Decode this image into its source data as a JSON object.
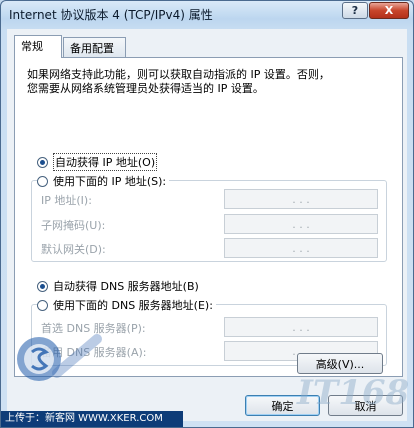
{
  "window": {
    "title": "Internet 协议版本 4 (TCP/IPv4) 属性",
    "help_label": "?",
    "close_label": "X"
  },
  "tabs": [
    {
      "label": "常规",
      "active": true
    },
    {
      "label": "备用配置",
      "active": false
    }
  ],
  "intro": {
    "line1": "如果网络支持此功能，则可以获取自动指派的 IP 设置。否则，",
    "line2": "您需要从网络系统管理员处获得适当的 IP 设置。"
  },
  "ip_section": {
    "auto_label": "自动获得 IP 地址(O)",
    "auto_selected": true,
    "manual_label": "使用下面的 IP 地址(S):",
    "fields": [
      {
        "label": "IP 地址(I):",
        "value": ". . ."
      },
      {
        "label": "子网掩码(U):",
        "value": ". . ."
      },
      {
        "label": "默认网关(D):",
        "value": ". . ."
      }
    ]
  },
  "dns_section": {
    "auto_label": "自动获得 DNS 服务器地址(B)",
    "auto_selected": true,
    "manual_label": "使用下面的 DNS 服务器地址(E):",
    "fields": [
      {
        "label": "首选 DNS 服务器(P):",
        "value": ". . ."
      },
      {
        "label": "备用 DNS 服务器(A):",
        "value": ". . ."
      }
    ]
  },
  "buttons": {
    "advanced": "高级(V)...",
    "ok": "确定",
    "cancel": "取消"
  },
  "watermark": {
    "banner": "上传于：新客网 WWW.XKER.COM",
    "text": "IT168"
  }
}
